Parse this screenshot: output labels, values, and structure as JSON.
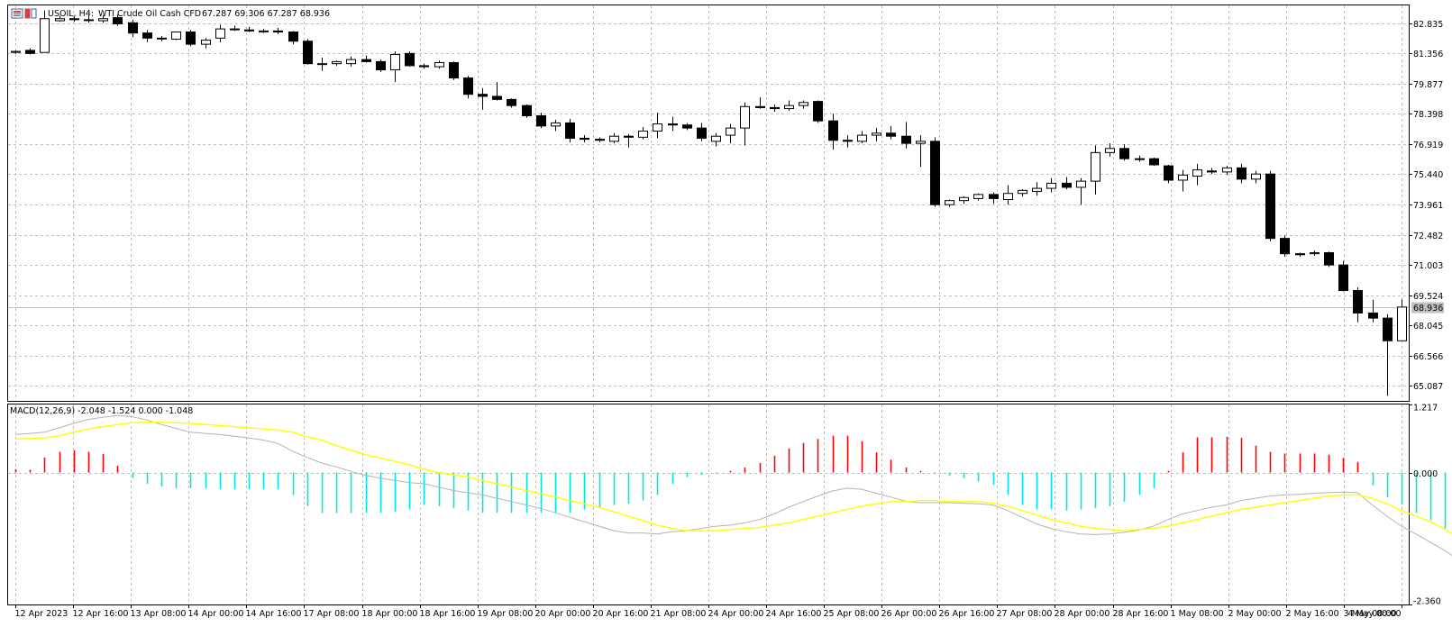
{
  "header": {
    "symbol": "USOIL, H4:",
    "description": "WTI Crude Oil Cash CFD",
    "ohlc": "67.287 69.306 67.287 68.936"
  },
  "indicator": {
    "label": "MACD(12,26,9) -2.048 -1.524 0.000 -1.048"
  },
  "colors": {
    "grid": "#c0c0c0",
    "bull_body": "#ffffff",
    "bear_body": "#000000",
    "hist_pos": "#ff0000",
    "hist_neg": "#00e5e5",
    "macd_line": "#b4b4b4",
    "signal_line": "#ffff00",
    "price_line": "#c0c0c0"
  },
  "chart_data": {
    "price_panel": {
      "type": "candlestick",
      "symbol": "USOIL",
      "timeframe": "H4",
      "ylim": [
        64.35,
        83.7
      ],
      "y_ticks": [
        "82.835",
        "81.356",
        "79.877",
        "78.398",
        "76.919",
        "75.440",
        "73.961",
        "72.482",
        "71.003",
        "69.524",
        "68.045",
        "66.566",
        "65.087"
      ],
      "current_price": "68.936",
      "candles": [
        [
          81.4,
          81.5,
          81.35,
          81.45
        ],
        [
          81.5,
          81.6,
          81.3,
          81.35
        ],
        [
          81.4,
          83.45,
          81.4,
          83.05
        ],
        [
          82.95,
          83.2,
          82.9,
          83.05
        ],
        [
          83.05,
          83.15,
          82.9,
          83.0
        ],
        [
          83.0,
          83.2,
          82.85,
          82.98
        ],
        [
          82.95,
          83.2,
          82.85,
          83.05
        ],
        [
          83.1,
          83.25,
          82.7,
          82.8
        ],
        [
          82.85,
          83.0,
          82.15,
          82.35
        ],
        [
          82.35,
          82.5,
          81.9,
          82.1
        ],
        [
          82.1,
          82.2,
          81.95,
          82.1
        ],
        [
          82.05,
          82.4,
          82.0,
          82.4
        ],
        [
          82.4,
          82.5,
          81.7,
          81.8
        ],
        [
          81.8,
          82.1,
          81.6,
          82.0
        ],
        [
          82.1,
          82.75,
          81.9,
          82.55
        ],
        [
          82.55,
          82.7,
          82.45,
          82.55
        ],
        [
          82.5,
          82.65,
          82.4,
          82.45
        ],
        [
          82.45,
          82.55,
          82.35,
          82.45
        ],
        [
          82.45,
          82.6,
          82.3,
          82.4
        ],
        [
          82.4,
          82.45,
          81.8,
          81.95
        ],
        [
          81.95,
          82.05,
          80.8,
          80.85
        ],
        [
          80.85,
          81.15,
          80.5,
          80.85
        ],
        [
          80.85,
          81.0,
          80.75,
          80.95
        ],
        [
          80.85,
          81.2,
          80.7,
          81.05
        ],
        [
          81.05,
          81.25,
          80.9,
          80.95
        ],
        [
          80.95,
          81.05,
          80.45,
          80.55
        ],
        [
          80.55,
          81.45,
          79.95,
          81.3
        ],
        [
          81.35,
          81.45,
          80.7,
          80.75
        ],
        [
          80.75,
          80.85,
          80.6,
          80.7
        ],
        [
          80.7,
          81.0,
          80.6,
          80.9
        ],
        [
          80.9,
          80.95,
          80.05,
          80.15
        ],
        [
          80.15,
          80.25,
          79.15,
          79.35
        ],
        [
          79.35,
          79.65,
          78.6,
          79.25
        ],
        [
          79.25,
          79.95,
          79.05,
          79.1
        ],
        [
          79.1,
          79.15,
          78.7,
          78.8
        ],
        [
          78.8,
          78.85,
          78.2,
          78.3
        ],
        [
          78.3,
          78.45,
          77.7,
          77.8
        ],
        [
          77.8,
          78.1,
          77.55,
          77.95
        ],
        [
          77.95,
          78.15,
          77.0,
          77.2
        ],
        [
          77.2,
          77.35,
          77.0,
          77.15
        ],
        [
          77.15,
          77.25,
          77.0,
          77.1
        ],
        [
          77.05,
          77.45,
          76.95,
          77.3
        ],
        [
          77.3,
          77.4,
          76.75,
          77.25
        ],
        [
          77.25,
          77.75,
          77.15,
          77.55
        ],
        [
          77.55,
          78.45,
          77.2,
          77.9
        ],
        [
          77.9,
          78.25,
          77.55,
          77.85
        ],
        [
          77.85,
          77.95,
          77.6,
          77.7
        ],
        [
          77.7,
          77.95,
          77.05,
          77.2
        ],
        [
          77.05,
          77.45,
          76.8,
          77.3
        ],
        [
          77.35,
          77.9,
          76.95,
          77.7
        ],
        [
          77.7,
          78.95,
          76.85,
          78.75
        ],
        [
          78.75,
          79.2,
          78.65,
          78.7
        ],
        [
          78.7,
          78.85,
          78.5,
          78.65
        ],
        [
          78.65,
          79.05,
          78.55,
          78.8
        ],
        [
          78.8,
          79.05,
          78.65,
          78.95
        ],
        [
          79.0,
          79.05,
          77.95,
          78.05
        ],
        [
          78.05,
          78.4,
          76.65,
          77.1
        ],
        [
          77.1,
          77.35,
          76.75,
          77.05
        ],
        [
          77.05,
          77.55,
          76.95,
          77.35
        ],
        [
          77.35,
          77.7,
          77.05,
          77.45
        ],
        [
          77.45,
          77.8,
          77.15,
          77.3
        ],
        [
          77.3,
          78.0,
          76.7,
          76.95
        ],
        [
          76.95,
          77.35,
          75.8,
          77.05
        ],
        [
          77.05,
          77.25,
          73.85,
          73.95
        ],
        [
          73.95,
          74.2,
          73.85,
          74.15
        ],
        [
          74.15,
          74.35,
          74.0,
          74.3
        ],
        [
          74.25,
          74.5,
          74.15,
          74.45
        ],
        [
          74.45,
          74.55,
          74.0,
          74.25
        ],
        [
          74.2,
          74.9,
          73.95,
          74.5
        ],
        [
          74.5,
          74.7,
          74.35,
          74.65
        ],
        [
          74.6,
          75.05,
          74.4,
          74.75
        ],
        [
          74.75,
          75.25,
          74.55,
          75.0
        ],
        [
          75.0,
          75.3,
          74.7,
          74.8
        ],
        [
          74.8,
          75.25,
          73.95,
          75.1
        ],
        [
          75.1,
          76.85,
          74.45,
          76.5
        ],
        [
          76.5,
          76.95,
          76.3,
          76.7
        ],
        [
          76.7,
          76.9,
          76.1,
          76.2
        ],
        [
          76.2,
          76.35,
          76.05,
          76.2
        ],
        [
          76.2,
          76.25,
          75.85,
          75.9
        ],
        [
          75.85,
          75.9,
          75.0,
          75.15
        ],
        [
          75.15,
          75.65,
          74.6,
          75.4
        ],
        [
          75.35,
          75.95,
          74.9,
          75.65
        ],
        [
          75.6,
          75.75,
          75.45,
          75.55
        ],
        [
          75.55,
          75.85,
          75.4,
          75.75
        ],
        [
          75.75,
          75.95,
          75.0,
          75.2
        ],
        [
          75.2,
          75.6,
          75.0,
          75.45
        ],
        [
          75.45,
          75.6,
          72.15,
          72.3
        ],
        [
          72.3,
          72.45,
          71.4,
          71.55
        ],
        [
          71.55,
          71.6,
          71.4,
          71.5
        ],
        [
          71.55,
          71.7,
          71.45,
          71.6
        ],
        [
          71.6,
          71.65,
          70.9,
          71.0
        ],
        [
          71.0,
          71.2,
          69.7,
          69.75
        ],
        [
          69.75,
          69.9,
          68.2,
          68.65
        ],
        [
          68.65,
          69.3,
          68.2,
          68.4
        ],
        [
          68.4,
          68.6,
          64.6,
          67.29
        ],
        [
          67.29,
          69.31,
          67.29,
          68.94
        ]
      ],
      "x_tick_labels": [
        "12 Apr 2023",
        "12 Apr 16:00",
        "13 Apr 08:00",
        "14 Apr 00:00",
        "14 Apr 16:00",
        "17 Apr 08:00",
        "18 Apr 00:00",
        "18 Apr 16:00",
        "19 Apr 08:00",
        "20 Apr 00:00",
        "20 Apr 16:00",
        "21 Apr 08:00",
        "24 Apr 00:00",
        "24 Apr 16:00",
        "25 Apr 08:00",
        "26 Apr 00:00",
        "26 Apr 16:00",
        "27 Apr 08:00",
        "28 Apr 00:00",
        "28 Apr 16:00",
        "1 May 08:00",
        "2 May 00:00",
        "2 May 16:00",
        "3 May 08:00",
        "4 May 00:00"
      ]
    },
    "macd_panel": {
      "type": "line+histogram",
      "ylim": [
        -2.36,
        1.217
      ],
      "y_ticks": [
        "1.217",
        "0.000",
        "-2.360"
      ],
      "histogram": [
        0.06,
        0.05,
        0.27,
        0.37,
        0.4,
        0.37,
        0.33,
        0.12,
        -0.1,
        -0.2,
        -0.25,
        -0.28,
        -0.28,
        -0.28,
        -0.3,
        -0.3,
        -0.3,
        -0.3,
        -0.3,
        -0.4,
        -0.6,
        -0.72,
        -0.72,
        -0.72,
        -0.72,
        -0.72,
        -0.7,
        -0.66,
        -0.58,
        -0.6,
        -0.64,
        -0.68,
        -0.72,
        -0.72,
        -0.72,
        -0.72,
        -0.72,
        -0.72,
        -0.72,
        -0.66,
        -0.62,
        -0.58,
        -0.56,
        -0.5,
        -0.4,
        -0.2,
        -0.08,
        -0.04,
        -0.02,
        0.03,
        0.09,
        0.17,
        0.3,
        0.43,
        0.53,
        0.6,
        0.66,
        0.66,
        0.56,
        0.36,
        0.23,
        0.09,
        0.03,
        -0.02,
        -0.06,
        -0.1,
        -0.16,
        -0.22,
        -0.4,
        -0.58,
        -0.66,
        -0.66,
        -0.68,
        -0.66,
        -0.64,
        -0.6,
        -0.52,
        -0.4,
        -0.28,
        0.03,
        0.36,
        0.63,
        0.63,
        0.64,
        0.62,
        0.48,
        0.37,
        0.34,
        0.34,
        0.34,
        0.32,
        0.26,
        0.19,
        -0.23,
        -0.44,
        -0.57,
        -0.72,
        -0.85,
        -1.0,
        -1.3,
        -1.56,
        -1.6,
        -1.5
      ],
      "macd": [
        0.68,
        0.7,
        0.72,
        0.8,
        0.88,
        0.95,
        0.99,
        1.02,
        1.0,
        0.94,
        0.86,
        0.79,
        0.72,
        0.7,
        0.68,
        0.65,
        0.62,
        0.58,
        0.52,
        0.38,
        0.27,
        0.17,
        0.1,
        0.02,
        -0.05,
        -0.1,
        -0.14,
        -0.18,
        -0.2,
        -0.26,
        -0.32,
        -0.36,
        -0.4,
        -0.46,
        -0.52,
        -0.58,
        -0.64,
        -0.72,
        -0.8,
        -0.88,
        -0.96,
        -1.04,
        -1.08,
        -1.08,
        -1.1,
        -1.06,
        -1.04,
        -1.0,
        -0.96,
        -0.94,
        -0.9,
        -0.84,
        -0.74,
        -0.62,
        -0.52,
        -0.42,
        -0.33,
        -0.28,
        -0.3,
        -0.37,
        -0.44,
        -0.51,
        -0.54,
        -0.54,
        -0.54,
        -0.55,
        -0.56,
        -0.58,
        -0.68,
        -0.8,
        -0.92,
        -1.0,
        -1.06,
        -1.1,
        -1.11,
        -1.1,
        -1.07,
        -1.03,
        -0.96,
        -0.84,
        -0.74,
        -0.68,
        -0.62,
        -0.58,
        -0.5,
        -0.46,
        -0.42,
        -0.4,
        -0.39,
        -0.37,
        -0.36,
        -0.35,
        -0.36,
        -0.58,
        -0.78,
        -0.96,
        -1.1,
        -1.25,
        -1.4,
        -1.58,
        -1.75,
        -1.98,
        -2.05
      ],
      "signal": [
        0.6,
        0.61,
        0.62,
        0.66,
        0.72,
        0.78,
        0.82,
        0.86,
        0.89,
        0.9,
        0.9,
        0.89,
        0.88,
        0.86,
        0.84,
        0.82,
        0.8,
        0.78,
        0.76,
        0.72,
        0.64,
        0.58,
        0.48,
        0.4,
        0.32,
        0.26,
        0.2,
        0.14,
        0.06,
        0.0,
        -0.04,
        -0.08,
        -0.14,
        -0.2,
        -0.26,
        -0.32,
        -0.38,
        -0.44,
        -0.5,
        -0.56,
        -0.62,
        -0.7,
        -0.78,
        -0.86,
        -0.94,
        -1.0,
        -1.04,
        -1.04,
        -1.04,
        -1.02,
        -1.0,
        -0.98,
        -0.94,
        -0.9,
        -0.84,
        -0.78,
        -0.72,
        -0.66,
        -0.6,
        -0.56,
        -0.52,
        -0.52,
        -0.5,
        -0.5,
        -0.52,
        -0.52,
        -0.52,
        -0.55,
        -0.6,
        -0.68,
        -0.76,
        -0.84,
        -0.9,
        -0.96,
        -1.0,
        -1.02,
        -1.04,
        -1.02,
        -1.0,
        -0.96,
        -0.9,
        -0.84,
        -0.78,
        -0.72,
        -0.66,
        -0.62,
        -0.58,
        -0.54,
        -0.5,
        -0.46,
        -0.42,
        -0.4,
        -0.4,
        -0.46,
        -0.56,
        -0.68,
        -0.78,
        -0.88,
        -1.02,
        -1.18,
        -1.35,
        -1.52,
        -1.62
      ]
    }
  }
}
